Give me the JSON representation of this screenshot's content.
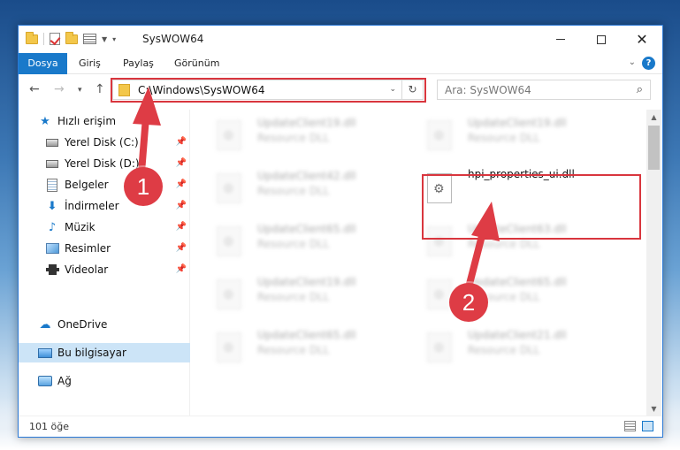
{
  "window": {
    "title": "SysWOW64"
  },
  "ribbon": {
    "tabs": [
      "Dosya",
      "Giriş",
      "Paylaş",
      "Görünüm"
    ],
    "help": "?"
  },
  "address_bar": {
    "path": "C:\\Windows\\SysWOW64"
  },
  "search": {
    "placeholder": "Ara: SysWOW64"
  },
  "sidebar": {
    "items": [
      {
        "label": "Hızlı erişim",
        "icon": "star-icon"
      },
      {
        "label": "Yerel Disk (C:)",
        "icon": "disk-icon",
        "pinned": true
      },
      {
        "label": "Yerel Disk (D:)",
        "icon": "disk-icon",
        "pinned": true
      },
      {
        "label": "Belgeler",
        "icon": "document-icon",
        "pinned": true
      },
      {
        "label": "İndirmeler",
        "icon": "download-icon",
        "pinned": true
      },
      {
        "label": "Müzik",
        "icon": "music-icon",
        "pinned": true
      },
      {
        "label": "Resimler",
        "icon": "picture-icon",
        "pinned": true
      },
      {
        "label": "Videolar",
        "icon": "video-icon",
        "pinned": true
      },
      {
        "label": "OneDrive",
        "icon": "cloud-icon"
      },
      {
        "label": "Bu bilgisayar",
        "icon": "computer-icon",
        "selected": true
      },
      {
        "label": "Ağ",
        "icon": "network-icon"
      }
    ]
  },
  "files": [
    {
      "name": "UpdateClient19.dll",
      "type": "Resource DLL"
    },
    {
      "name": "UpdateClient19.dll",
      "type": "Resource DLL"
    },
    {
      "name": "UpdateClient42.dll",
      "type": "Resource DLL"
    },
    {
      "name": "hpi_properties_ui.dll",
      "type": ""
    },
    {
      "name": "UpdateClient65.dll",
      "type": "Resource DLL"
    },
    {
      "name": "UpdateClient63.dll",
      "type": "Resource DLL"
    },
    {
      "name": "UpdateClient19.dll",
      "type": "Resource DLL"
    },
    {
      "name": "UpdateClient65.dll",
      "type": "Resource DLL"
    },
    {
      "name": "UpdateClient65.dll",
      "type": "Resource DLL"
    },
    {
      "name": "UpdateClient21.dll",
      "type": "Resource DLL"
    }
  ],
  "status": {
    "count": "101 öğe"
  },
  "annotations": {
    "badge1": "1",
    "badge2": "2",
    "color": "#de3c45"
  }
}
